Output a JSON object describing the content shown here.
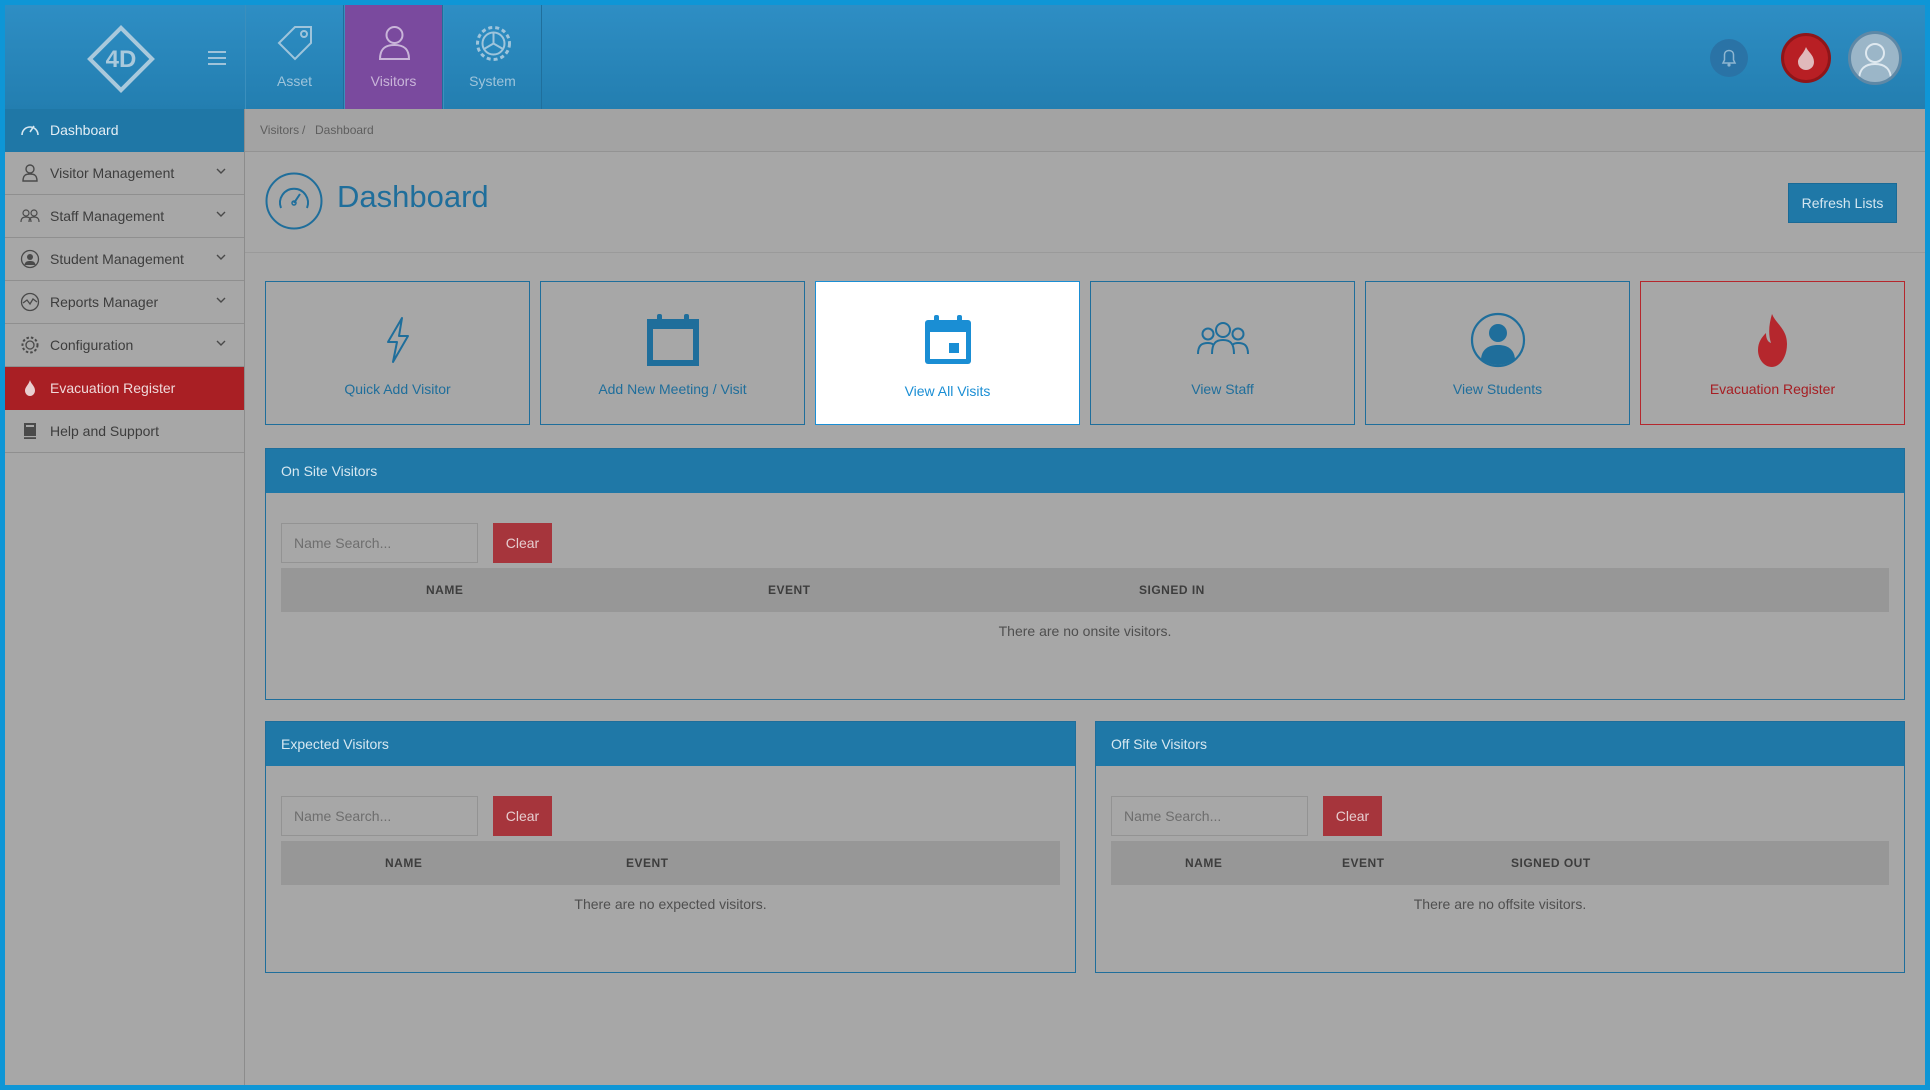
{
  "topnav": {
    "items": [
      {
        "label": "Asset",
        "icon": "tag-icon"
      },
      {
        "label": "Visitors",
        "icon": "person-icon"
      },
      {
        "label": "System",
        "icon": "gear-icon"
      }
    ],
    "active": "Visitors"
  },
  "colors": {
    "brand": "#2e8ec4",
    "active_nav": "#7a4a9e",
    "danger": "#a91f24",
    "page_bg": "#a7a7a7"
  },
  "sidebar": {
    "items": [
      {
        "label": "Dashboard",
        "icon": "speedometer-icon"
      },
      {
        "label": "Visitor Management",
        "icon": "person-icon"
      },
      {
        "label": "Staff Management",
        "icon": "group-icon"
      },
      {
        "label": "Student Management",
        "icon": "student-icon"
      },
      {
        "label": "Reports Manager",
        "icon": "chart-icon"
      },
      {
        "label": "Configuration",
        "icon": "gear-icon"
      },
      {
        "label": "Evacuation Register",
        "icon": "fire-icon"
      },
      {
        "label": "Help and Support",
        "icon": "book-icon"
      }
    ]
  },
  "breadcrumb": {
    "parent": "Visitors",
    "sep": "/",
    "current": "Dashboard"
  },
  "page": {
    "title": "Dashboard",
    "refresh_label": "Refresh Lists"
  },
  "tiles": [
    {
      "label": "Quick Add Visitor",
      "icon": "lightning-icon"
    },
    {
      "label": "Add New Meeting / Visit",
      "icon": "calendar-icon"
    },
    {
      "label": "View All Visits",
      "icon": "calendar-day-icon"
    },
    {
      "label": "View Staff",
      "icon": "group-icon"
    },
    {
      "label": "View Students",
      "icon": "student-icon"
    },
    {
      "label": "Evacuation Register",
      "icon": "fire-icon"
    }
  ],
  "onsite": {
    "title": "On Site Visitors",
    "search_placeholder": "Name Search...",
    "clear_label": "Clear",
    "columns": [
      "NAME",
      "EVENT",
      "SIGNED IN"
    ],
    "empty": "There are no onsite visitors."
  },
  "expected": {
    "title": "Expected Visitors",
    "search_placeholder": "Name Search...",
    "clear_label": "Clear",
    "columns": [
      "NAME",
      "EVENT"
    ],
    "empty": "There are no expected visitors."
  },
  "offsite": {
    "title": "Off Site Visitors",
    "search_placeholder": "Name Search...",
    "clear_label": "Clear",
    "columns": [
      "NAME",
      "EVENT",
      "SIGNED OUT"
    ],
    "empty": "There are no offsite visitors."
  }
}
